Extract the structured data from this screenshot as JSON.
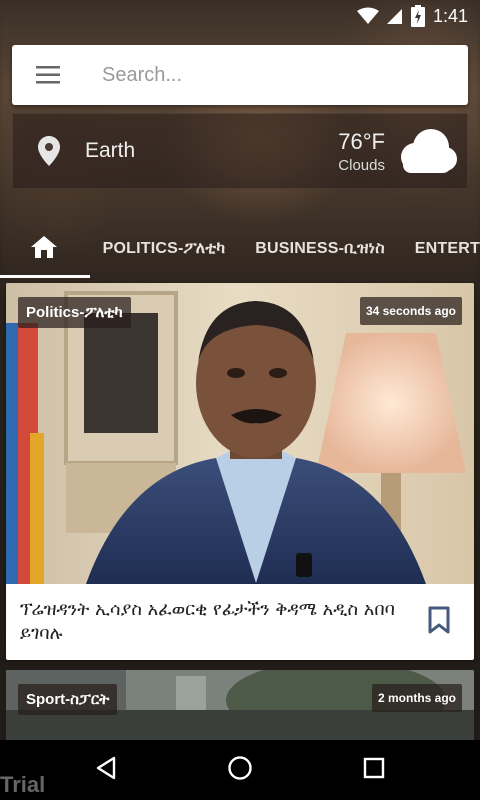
{
  "status_bar": {
    "time": "1:41",
    "icons": [
      "wifi-icon",
      "signal-icon",
      "battery-charging-icon"
    ]
  },
  "search": {
    "placeholder": "Search...",
    "menu_icon": "hamburger-menu-icon"
  },
  "weather": {
    "location": "Earth",
    "temperature": "76°F",
    "condition": "Clouds",
    "icon": "cloud-icon"
  },
  "tabs": {
    "home_icon": "home-icon",
    "items": [
      {
        "label": "POLITICS-ፖለቲካ"
      },
      {
        "label": "BUSINESS-ቢዝነስ"
      },
      {
        "label": "ENTERT"
      }
    ]
  },
  "articles": [
    {
      "category": "Politics-ፖለቲካ",
      "time": "34 seconds ago",
      "title": "ፕሬዝዳንት ኢሳያስ አፈወርቂ የፊታችን ቅዳሜ አዲስ አበባ ይገባሉ",
      "bookmark_icon": "bookmark-icon"
    },
    {
      "category": "Sport-ስፓርት",
      "time": "2 months ago"
    }
  ],
  "nav": {
    "back": "back-icon",
    "home": "home-circle-icon",
    "recents": "recents-icon"
  },
  "watermark": "Trial",
  "colors": {
    "accent_underline": "#ffffff",
    "card_background": "#ffffff",
    "badge_background": "#2b1f1c"
  }
}
